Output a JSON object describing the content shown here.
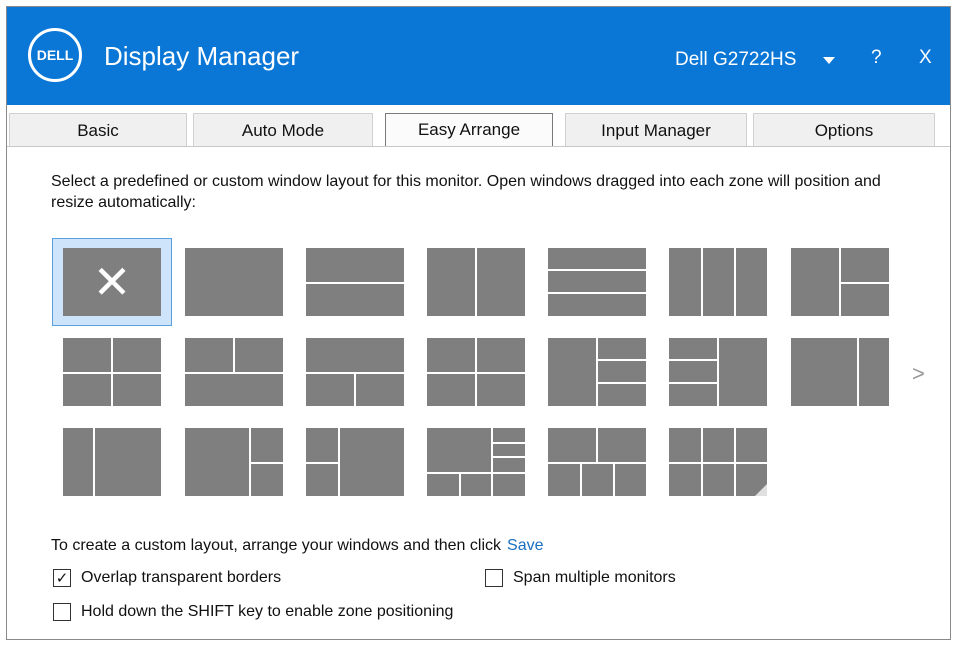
{
  "titlebar": {
    "logo_text": "DELL",
    "app_title": "Display Manager",
    "monitor_name": "Dell G2722HS",
    "help_label": "?",
    "close_label": "X",
    "background": "#0a76d6"
  },
  "tabs": [
    {
      "label": "Basic"
    },
    {
      "label": "Auto Mode"
    },
    {
      "label": "Easy Arrange",
      "active": true
    },
    {
      "label": "Input Manager"
    },
    {
      "label": "Options"
    }
  ],
  "description": "Select a predefined or custom window layout for this monitor.  Open windows dragged into each zone will position and resize automatically:",
  "layouts": {
    "selected_index": 0,
    "next_page_icon": ">",
    "tile_color": "#7f7f7f",
    "selection_color": "#cde4fa"
  },
  "custom": {
    "text": "To create a custom layout, arrange your windows and then click",
    "save_label": "Save"
  },
  "options": {
    "overlap": {
      "label": "Overlap transparent borders",
      "checked": true
    },
    "span": {
      "label": "Span multiple monitors",
      "checked": false
    },
    "shift": {
      "label": "Hold down the SHIFT key to enable zone positioning",
      "checked": false
    }
  }
}
